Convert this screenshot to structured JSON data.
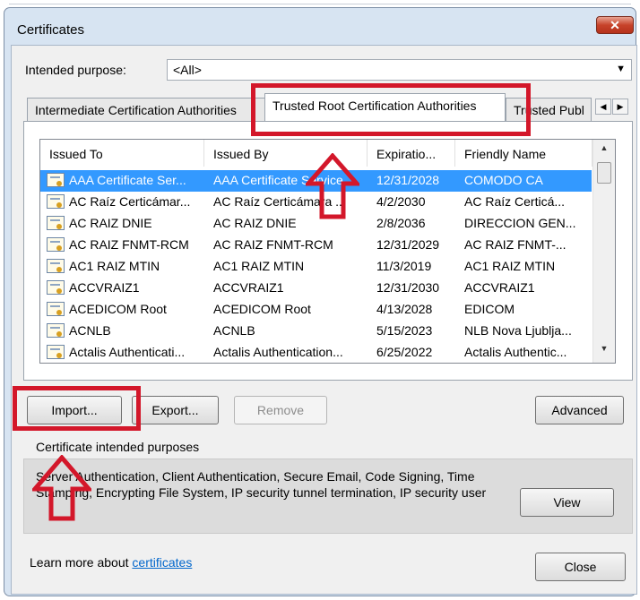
{
  "window": {
    "title": "Certificates",
    "close_glyph": "✕"
  },
  "intended_purpose": {
    "label": "Intended purpose:",
    "value": "<All>"
  },
  "tabs": [
    {
      "label": "Intermediate Certification Authorities",
      "active": false
    },
    {
      "label": "Trusted Root Certification Authorities",
      "active": true
    },
    {
      "label": "Trusted Publ",
      "active": false
    }
  ],
  "columns": [
    "Issued To",
    "Issued By",
    "Expiratio...",
    "Friendly Name"
  ],
  "rows": [
    {
      "issued_to": "AAA Certificate Ser...",
      "issued_by": "AAA Certificate Service",
      "expiration": "12/31/2028",
      "friendly_name": "COMODO CA",
      "selected": true
    },
    {
      "issued_to": "AC Raíz Certicámar...",
      "issued_by": "AC Raíz Certicámara ...",
      "expiration": "4/2/2030",
      "friendly_name": "AC Raíz Certicá...",
      "selected": false
    },
    {
      "issued_to": "AC RAIZ DNIE",
      "issued_by": "AC RAIZ DNIE",
      "expiration": "2/8/2036",
      "friendly_name": "DIRECCION GEN...",
      "selected": false
    },
    {
      "issued_to": "AC RAIZ FNMT-RCM",
      "issued_by": "AC RAIZ FNMT-RCM",
      "expiration": "12/31/2029",
      "friendly_name": "AC RAIZ FNMT-...",
      "selected": false
    },
    {
      "issued_to": "AC1 RAIZ MTIN",
      "issued_by": "AC1 RAIZ MTIN",
      "expiration": "11/3/2019",
      "friendly_name": "AC1 RAIZ MTIN",
      "selected": false
    },
    {
      "issued_to": "ACCVRAIZ1",
      "issued_by": "ACCVRAIZ1",
      "expiration": "12/31/2030",
      "friendly_name": "ACCVRAIZ1",
      "selected": false
    },
    {
      "issued_to": "ACEDICOM Root",
      "issued_by": "ACEDICOM Root",
      "expiration": "4/13/2028",
      "friendly_name": "EDICOM",
      "selected": false
    },
    {
      "issued_to": "ACNLB",
      "issued_by": "ACNLB",
      "expiration": "5/15/2023",
      "friendly_name": "NLB Nova Ljublja...",
      "selected": false
    },
    {
      "issued_to": "Actalis Authenticati...",
      "issued_by": "Actalis Authentication...",
      "expiration": "6/25/2022",
      "friendly_name": "Actalis Authentic...",
      "selected": false
    }
  ],
  "buttons": {
    "import": "Import...",
    "export": "Export...",
    "remove": "Remove",
    "advanced": "Advanced",
    "view": "View",
    "close": "Close"
  },
  "purposes_group": {
    "title": "Certificate intended purposes",
    "text": "Server Authentication, Client Authentication, Secure Email, Code Signing, Time Stamping, Encrypting File System, IP security tunnel termination, IP security user"
  },
  "footer": {
    "learn_prefix": "Learn more about ",
    "learn_link": "certificates"
  },
  "colors": {
    "selection": "#3399ff",
    "annotation": "#d3172a",
    "link": "#0066cc"
  }
}
